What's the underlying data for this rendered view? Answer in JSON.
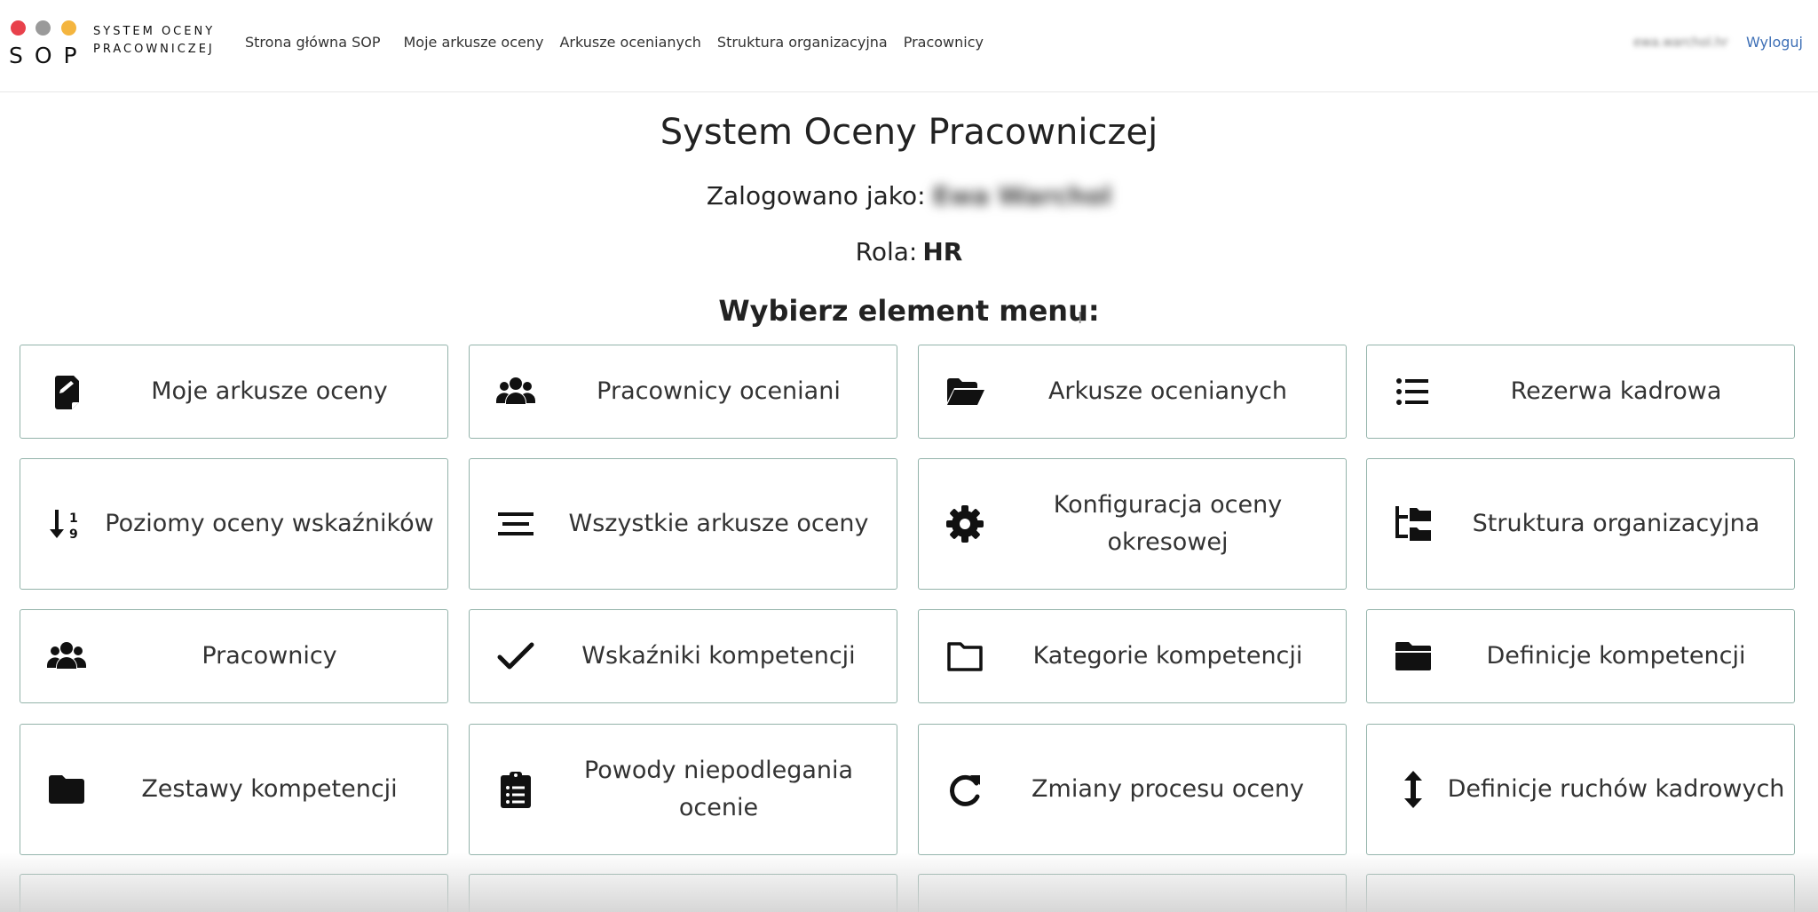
{
  "colors": {
    "dot_red": "#e8414b",
    "dot_grey": "#9a9a9a",
    "dot_yellow": "#f4b53f",
    "tile_border": "#93b3aa",
    "link_blue": "#3d6fb6"
  },
  "logo": {
    "abbr": "SOP",
    "full_line1": "SYSTEM OCENY",
    "full_line2": "PRACOWNICZEJ"
  },
  "nav": {
    "links": [
      "Strona główna SOP",
      "Moje arkusze oceny",
      "Arkusze ocenianych",
      "Struktura organizacyjna",
      "Pracownicy"
    ],
    "user_email": "ewa.warchol.hr",
    "logout": "Wyloguj"
  },
  "main": {
    "title": "System Oceny Pracowniczej",
    "logged_as_label": "Zalogowano jako:",
    "logged_as_name": "Ewa Warchol",
    "role_label": "Rola:",
    "role_value": "HR",
    "choose_label": "Wybierz element menu:"
  },
  "tiles": [
    {
      "label": "Moje arkusze oceny",
      "icon": "file-signature-icon"
    },
    {
      "label": "Pracownicy oceniani",
      "icon": "users-icon"
    },
    {
      "label": "Arkusze ocenianych",
      "icon": "folder-open-icon"
    },
    {
      "label": "Rezerwa kadrowa",
      "icon": "list-icon"
    },
    {
      "label": "Poziomy oceny wskaźników",
      "icon": "sort-numeric-down-icon"
    },
    {
      "label": "Wszystkie arkusze oceny",
      "icon": "align-center-icon"
    },
    {
      "label": "Konfiguracja oceny okresowej",
      "icon": "gear-icon"
    },
    {
      "label": "Struktura organizacyjna",
      "icon": "folder-tree-icon"
    },
    {
      "label": "Pracownicy",
      "icon": "users-icon"
    },
    {
      "label": "Wskaźniki kompetencji",
      "icon": "check-icon"
    },
    {
      "label": "Kategorie kompetencji",
      "icon": "folder-outline-icon"
    },
    {
      "label": "Definicje kompetencji",
      "icon": "folder-filled-icon"
    },
    {
      "label": "Zestawy kompetencji",
      "icon": "folder-solid-icon"
    },
    {
      "label": "Powody niepodlegania ocenie",
      "icon": "clipboard-list-icon"
    },
    {
      "label": "Zmiany procesu oceny",
      "icon": "redo-icon"
    },
    {
      "label": "Definicje ruchów kadrowych",
      "icon": "arrows-vertical-icon"
    }
  ]
}
